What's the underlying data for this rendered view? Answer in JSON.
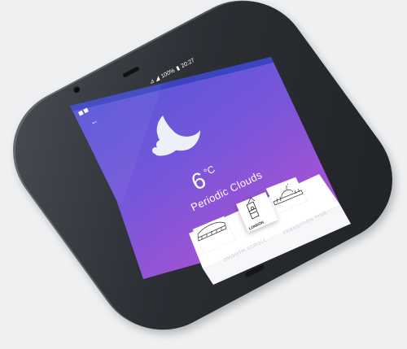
{
  "status_bar": {
    "signal": "⊿ ◢",
    "battery": "100%",
    "time": "20:27"
  },
  "weather": {
    "temperature": "6",
    "unit": "°C",
    "condition": "Periodic Clouds",
    "icon": "moon-cloud-icon"
  },
  "cities": [
    {
      "name": "",
      "icon": "colosseum-icon"
    },
    {
      "name": "LONDON",
      "icon": "big-ben-icon",
      "selected": true
    },
    {
      "name": "",
      "icon": "capitol-icon"
    }
  ],
  "bottom_labels": {
    "left": "SMOOTH SCROLL",
    "right": "TRANSITION TIME"
  },
  "colors": {
    "gradient_top": "#4a57d8",
    "gradient_bottom": "#a24bd6",
    "accent": "#b05fd6",
    "device": "#2b2f34",
    "background": "#eef0f2"
  }
}
